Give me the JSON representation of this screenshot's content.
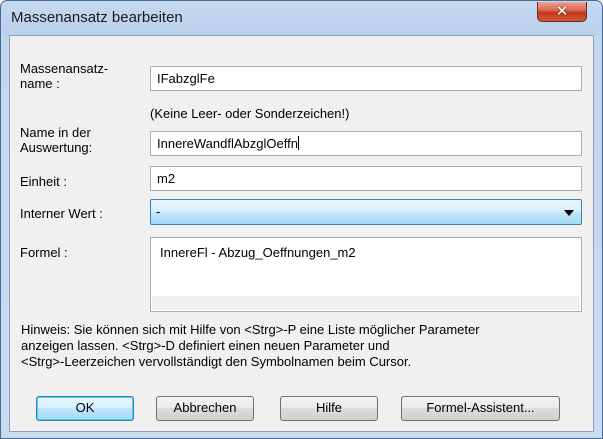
{
  "window": {
    "title": "Massenansatz bearbeiten",
    "close_icon": "close-icon"
  },
  "form": {
    "name_label": "Massenansatz-\nname :",
    "name_label_line1": "Massenansatz-",
    "name_label_line2": "name :",
    "name_value": "IFabzglFe",
    "name_hint": "(Keine Leer- oder Sonderzeichen!)",
    "eval_label_line1": "Name in der",
    "eval_label_line2": "Auswertung:",
    "eval_value": "InnereWandflAbzglOeffn",
    "unit_label": "Einheit :",
    "unit_value": "m2",
    "internal_label": "Interner Wert :",
    "internal_value": "-",
    "formula_label": "Formel :",
    "formula_value": "InnereFl - Abzug_Oeffnungen_m2"
  },
  "note": {
    "line1": "Hinweis: Sie können sich mit Hilfe von <Strg>-P eine Liste möglicher Parameter",
    "line2": "anzeigen lassen.  <Strg>-D definiert einen neuen Parameter und",
    "line3": "<Strg>-Leerzeichen vervollständigt den Symbolnamen beim Cursor."
  },
  "buttons": {
    "ok": "OK",
    "cancel": "Abbrechen",
    "help": "Hilfe",
    "assistant": "Formel-Assistent..."
  },
  "colors": {
    "accent": "#3c7fb1",
    "close": "#c4371c"
  }
}
